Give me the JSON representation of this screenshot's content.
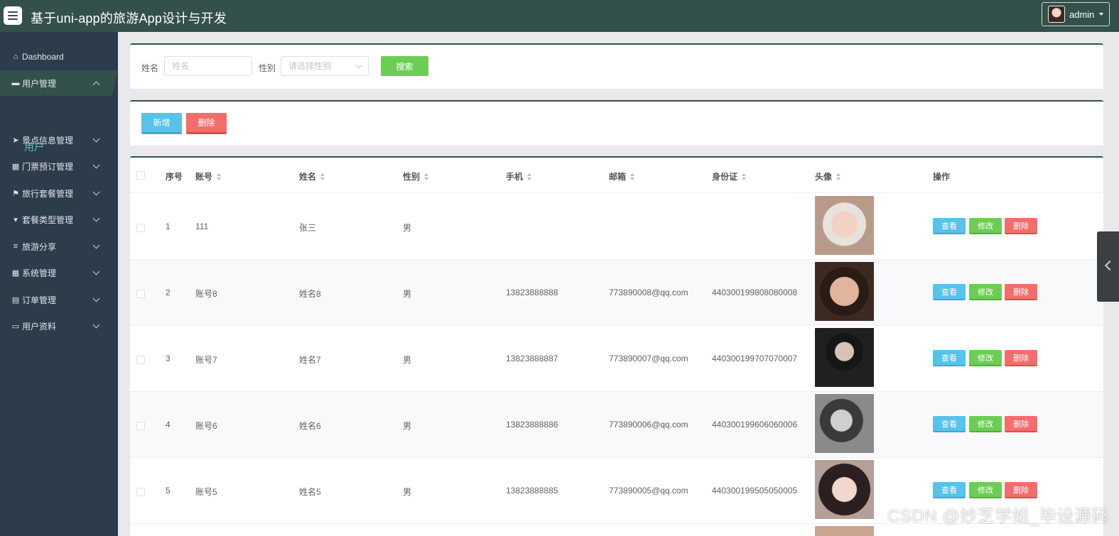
{
  "app": {
    "title": "基于uni-app的旅游App设计与开发",
    "user": "admin"
  },
  "sidebar": {
    "items": [
      {
        "label": "Dashboard",
        "icon": "home-icon"
      },
      {
        "label": "用户管理",
        "icon": "briefcase-icon",
        "active": true
      },
      {
        "label": "景点信息管理",
        "icon": "paper-plane-icon"
      },
      {
        "label": "门票预订管理",
        "icon": "grid-icon"
      },
      {
        "label": "旅行套餐管理",
        "icon": "flag-icon"
      },
      {
        "label": "套餐类型管理",
        "icon": "tag-icon"
      },
      {
        "label": "旅游分享",
        "icon": "list-icon"
      },
      {
        "label": "系统管理",
        "icon": "grid-icon"
      },
      {
        "label": "订单管理",
        "icon": "clipboard-icon"
      },
      {
        "label": "用户资料",
        "icon": "card-icon"
      }
    ],
    "sub_item": "用户"
  },
  "search": {
    "name_label": "姓名",
    "name_placeholder": "姓名",
    "gender_label": "性别",
    "gender_placeholder": "请选择性别",
    "search_button": "搜索"
  },
  "toolbar": {
    "add_button": "新增",
    "delete_button": "删除"
  },
  "table": {
    "headers": [
      "序号",
      "账号",
      "姓名",
      "性别",
      "手机",
      "邮箱",
      "身份证",
      "头像",
      "操作"
    ],
    "rows": [
      {
        "index": "1",
        "account": "111",
        "name": "张三",
        "gender": "男",
        "phone": "",
        "email": "",
        "id_card": ""
      },
      {
        "index": "2",
        "account": "账号8",
        "name": "姓名8",
        "gender": "男",
        "phone": "13823888888",
        "email": "773890008@qq.com",
        "id_card": "440300199808080008"
      },
      {
        "index": "3",
        "account": "账号7",
        "name": "姓名7",
        "gender": "男",
        "phone": "13823888887",
        "email": "773890007@qq.com",
        "id_card": "440300199707070007"
      },
      {
        "index": "4",
        "account": "账号6",
        "name": "姓名6",
        "gender": "男",
        "phone": "13823888886",
        "email": "773890006@qq.com",
        "id_card": "440300199606060006"
      },
      {
        "index": "5",
        "account": "账号5",
        "name": "姓名5",
        "gender": "男",
        "phone": "13823888885",
        "email": "773890005@qq.com",
        "id_card": "440300199505050005"
      }
    ],
    "actions": {
      "view": "查看",
      "edit": "修改",
      "delete": "删除"
    }
  },
  "watermark": "CSDN @妙芝学姐_毕设源码",
  "colors": {
    "header": "#34504b",
    "sidebar": "#2d3c4b",
    "primary": "#57c3ea",
    "success": "#6ccd55",
    "danger": "#f56c6c"
  }
}
